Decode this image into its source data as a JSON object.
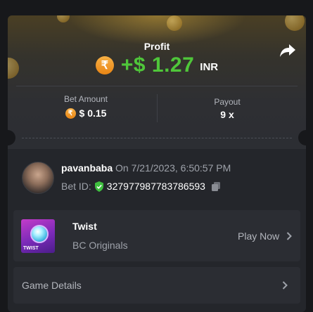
{
  "top_bar": {
    "title": ""
  },
  "profit": {
    "label": "Profit",
    "currency_symbol": "₹",
    "value": "+$ 1.27",
    "currency": "INR",
    "value_color": "#4fc63a"
  },
  "stats": {
    "bet_amount_label": "Bet Amount",
    "bet_amount_value": "$ 0.15",
    "payout_label": "Payout",
    "payout_value": "9 x"
  },
  "bet": {
    "username": "pavanbaba",
    "date": "On 7/21/2023, 6:50:57 PM",
    "bet_id_label": "Bet ID:",
    "bet_id": "327977987783786593"
  },
  "game": {
    "name": "Twist",
    "provider": "BC Originals",
    "play_label": "Play Now",
    "thumb_text": "TWIST"
  },
  "details": {
    "label": "Game Details"
  },
  "icons": {
    "share": "share-arrow-icon",
    "rupee": "rupee-coin-icon",
    "verified": "shield-check-icon",
    "copy": "copy-icon",
    "chevron": "chevron-right-icon"
  }
}
